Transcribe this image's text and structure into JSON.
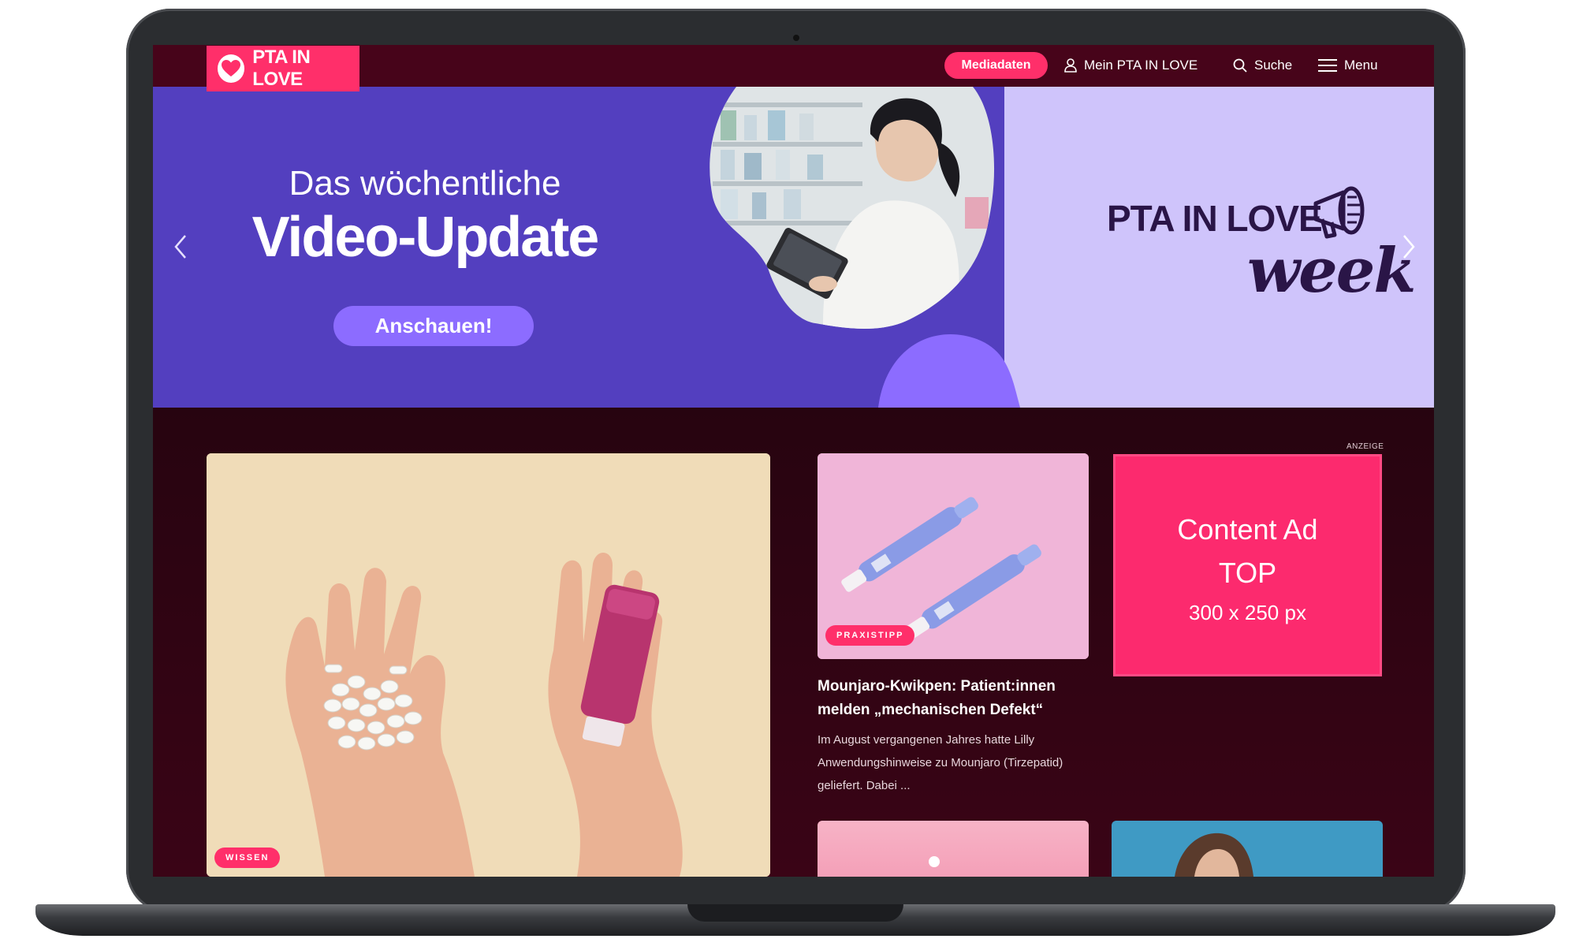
{
  "nav": {
    "logo_text": "PTA IN LOVE",
    "mediadaten_label": "Mediadaten",
    "account_label": "Mein PTA IN LOVE",
    "search_label": "Suche",
    "menu_label": "Menu"
  },
  "hero": {
    "kicker": "Das wöchentliche",
    "title": "Video-Update",
    "cta_label": "Anschauen!",
    "brand_line1": "PTA IN LOVE",
    "brand_line2": "week",
    "prev_icon": "chevron-left-icon",
    "next_icon": "chevron-right-icon"
  },
  "feature": {
    "badge": "WISSEN"
  },
  "card": {
    "badge": "PRAXISTIPP",
    "title": "Mounjaro-Kwikpen: Patient:innen melden „mechanischen Defekt“",
    "teaser": "Im August vergangenen Jahres hatte Lilly Anwendungshinweise zu Mounjaro (Tirzepatid) geliefert. Dabei ..."
  },
  "ad": {
    "label": "ANZEIGE",
    "line1": "Content Ad",
    "line2": "TOP",
    "line3": "300 x 250 px"
  },
  "colors": {
    "nav_bg": "#47041a",
    "brand_pink": "#ff2f6a",
    "hero_purple": "#533fbf",
    "hero_lavender": "#cfc4fb",
    "cta_purple": "#8c6cff",
    "content_bg": "#2a0510"
  }
}
